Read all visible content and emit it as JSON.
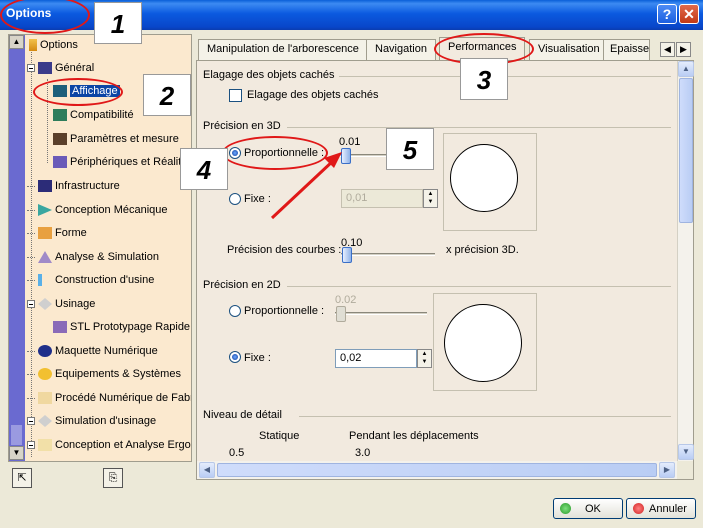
{
  "window": {
    "title": "Options",
    "help_glyph": "?",
    "close_glyph": "✕"
  },
  "tree": {
    "root": "Options",
    "items": [
      {
        "label": "Général"
      },
      {
        "label": "Affichage",
        "selected": true
      },
      {
        "label": "Compatibilité"
      },
      {
        "label": "Paramètres et mesure"
      },
      {
        "label": "Périphériques et Réalité"
      },
      {
        "label": "Infrastructure"
      },
      {
        "label": "Conception Mécanique"
      },
      {
        "label": "Forme"
      },
      {
        "label": "Analyse & Simulation"
      },
      {
        "label": "Construction d'usine"
      },
      {
        "label": "Usinage"
      },
      {
        "label": "STL Prototypage Rapide"
      },
      {
        "label": "Maquette Numérique"
      },
      {
        "label": "Equipements & Systèmes"
      },
      {
        "label": "Procédé Numérique de Fabri"
      },
      {
        "label": "Simulation d'usinage"
      },
      {
        "label": "Conception et Analyse Ergor"
      }
    ]
  },
  "tabs": [
    {
      "label": "Manipulation de l'arborescence"
    },
    {
      "label": "Navigation"
    },
    {
      "label": "Performances",
      "active": true
    },
    {
      "label": "Visualisation"
    },
    {
      "label": "Epaisse"
    }
  ],
  "content": {
    "culling": {
      "title": "Elagage des objets cachés",
      "checkbox_label": "Elagage des objets cachés",
      "checked": false
    },
    "precision3d": {
      "title": "Précision en 3D",
      "proportional_label": "Proportionnelle :",
      "proportional_selected": true,
      "slider_value": "0.01",
      "fixed_label": "Fixe :",
      "fixed_value": "0,01",
      "curves_label": "Précision des courbes :",
      "curves_value": "0.10",
      "curves_suffix": "x précision 3D."
    },
    "precision2d": {
      "title": "Précision en 2D",
      "proportional_label": "Proportionnelle :",
      "slider_value": "0.02",
      "fixed_label": "Fixe :",
      "fixed_selected": true,
      "fixed_value": "0,02"
    },
    "detail": {
      "title": "Niveau de détail",
      "static_label": "Statique",
      "moving_label": "Pendant les déplacements",
      "static_value": "0.5",
      "moving_value": "3.0"
    }
  },
  "buttons": {
    "ok": "OK",
    "cancel": "Annuler"
  },
  "annotations": [
    "1",
    "2",
    "3",
    "4",
    "5"
  ],
  "colors": {
    "annotation_red": "#e01818",
    "selection": "#0b45a5",
    "ok_green": "#2a9a2a",
    "cancel_red": "#d02020"
  }
}
